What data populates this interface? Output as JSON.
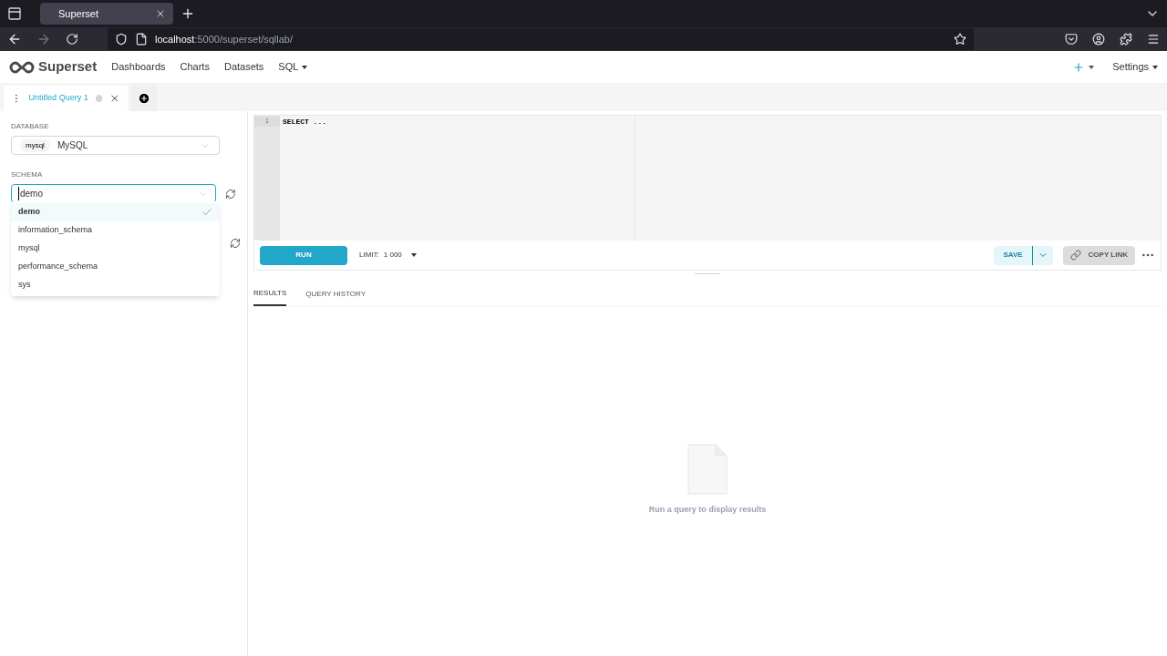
{
  "browser": {
    "tab_title": "Superset",
    "url_host": "localhost",
    "url_path": ":5000/superset/sqllab/"
  },
  "navbar": {
    "brand": "Superset",
    "items": [
      {
        "label": "Dashboards",
        "dropdown": false
      },
      {
        "label": "Charts",
        "dropdown": false
      },
      {
        "label": "Datasets",
        "dropdown": false
      },
      {
        "label": "SQL",
        "dropdown": true
      }
    ],
    "settings": "Settings"
  },
  "query_tabs": [
    {
      "label": "Untitled Query 1",
      "selected": true
    }
  ],
  "sidebar": {
    "database_label": "DATABASE",
    "database_tag": "mysql",
    "database_value": "MySQL",
    "schema_label": "SCHEMA",
    "schema_value": "demo",
    "schema_options": [
      {
        "label": "demo",
        "selected": true
      },
      {
        "label": "information_schema",
        "selected": false
      },
      {
        "label": "mysql",
        "selected": false
      },
      {
        "label": "performance_schema",
        "selected": false
      },
      {
        "label": "sys",
        "selected": false
      }
    ]
  },
  "editor": {
    "lines": [
      {
        "number": "1",
        "code": "SELECT ..."
      }
    ]
  },
  "toolbar": {
    "run": "RUN",
    "limit_label": "LIMIT:",
    "limit_value": "1 000",
    "save": "SAVE",
    "copy_link": "COPY LINK"
  },
  "result_tabs": [
    {
      "label": "RESULTS",
      "selected": true
    },
    {
      "label": "QUERY HISTORY",
      "selected": false
    }
  ],
  "empty_state": "Run a query to display results"
}
